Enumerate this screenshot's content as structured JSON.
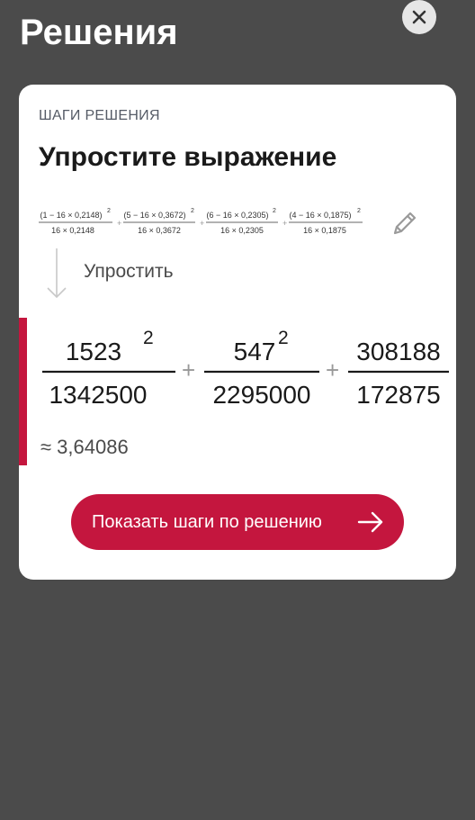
{
  "header": {
    "title": "Решения"
  },
  "card": {
    "section_label": "ШАГИ РЕШЕНИЯ",
    "title": "Упростите выражение",
    "original_expression": {
      "terms": [
        {
          "numerator": "(1 − 16 × 0,2148)",
          "exponent": "2",
          "denominator": "16 × 0,2148"
        },
        {
          "numerator": "(5 − 16 × 0,3672)",
          "exponent": "2",
          "denominator": "16 × 0,3672"
        },
        {
          "numerator": "(6 − 16 × 0,2305)",
          "exponent": "2",
          "denominator": "16 × 0,2305"
        },
        {
          "numerator": "(4 − 16 × 0,1875)",
          "exponent": "2",
          "denominator": "16 × 0,1875"
        }
      ],
      "operator": "+"
    },
    "step_label": "Упростить",
    "result_expression": {
      "terms": [
        {
          "numerator": "1523",
          "exponent": "2",
          "denominator": "1342500"
        },
        {
          "numerator": "547",
          "exponent": "2",
          "denominator": "2295000"
        },
        {
          "numerator": "308188",
          "exponent": "",
          "denominator": "172875"
        }
      ],
      "operator": "+"
    },
    "approx_value": "≈ 3,64086",
    "cta_label": "Показать шаги по решению"
  },
  "colors": {
    "accent": "#c4163e",
    "backdrop": "#4b4b4b",
    "card": "#ffffff"
  },
  "icons": [
    "close-icon",
    "pencil-icon",
    "arrow-down-icon",
    "arrow-right-icon"
  ]
}
